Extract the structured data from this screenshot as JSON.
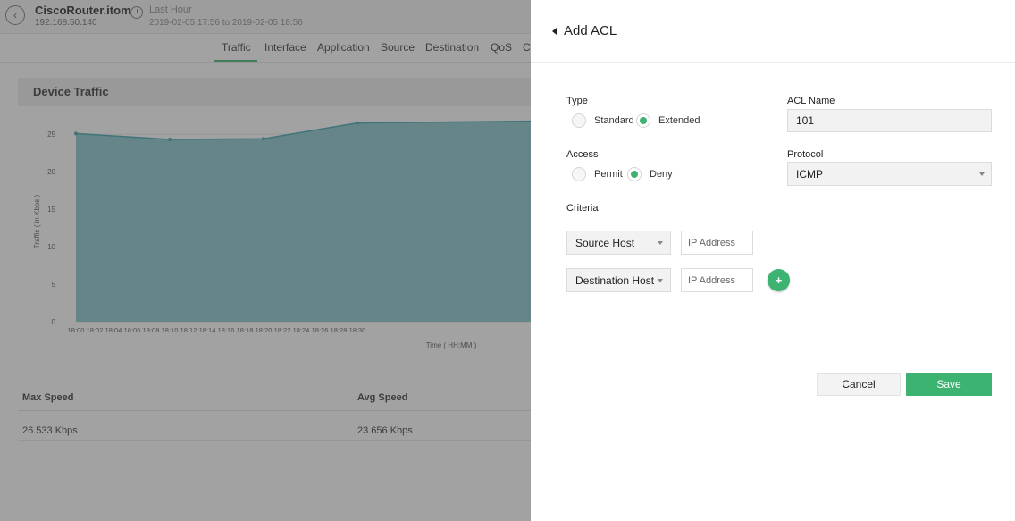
{
  "device": {
    "name": "CiscoRouter.itom",
    "ip": "192.168.50.140",
    "range_title": "Last Hour",
    "range_dates": "2019-02-05 17:56 to 2019-02-05 18:56"
  },
  "tabs": [
    "Traffic",
    "Interface",
    "Application",
    "Source",
    "Destination",
    "QoS",
    "C"
  ],
  "active_tab": "Traffic",
  "panel_title": "Device Traffic",
  "chart_data": {
    "type": "area",
    "xlabel": "Time ( HH:MM )",
    "ylabel": "Traffic ( in Kbps )",
    "x": [
      "18:00",
      "18:02",
      "18:04",
      "18:06",
      "18:08",
      "18:10",
      "18:12",
      "18:14",
      "18:16",
      "18:18",
      "18:20",
      "18:22",
      "18:24",
      "18:26",
      "18:28",
      "18:30"
    ],
    "points": [
      {
        "x": "18:00",
        "y": 25.1
      },
      {
        "x": "18:10",
        "y": 24.3
      },
      {
        "x": "18:20",
        "y": 24.4
      },
      {
        "x": "18:30",
        "y": 26.5
      }
    ],
    "y_ticks": [
      0,
      5,
      10,
      15,
      20,
      25
    ],
    "ylim": [
      0,
      28
    ],
    "fill_color": "#87c5cb",
    "line_color": "#3aa3ad"
  },
  "stats": {
    "max_label": "Max Speed",
    "avg_label": "Avg Speed",
    "max_value": "26.533 Kbps",
    "avg_value": "23.656 Kbps"
  },
  "acl": {
    "title": "Add ACL",
    "type_label": "Type",
    "type_options": [
      "Standard",
      "Extended"
    ],
    "type_selected": "Extended",
    "name_label": "ACL Name",
    "name_value": "101",
    "access_label": "Access",
    "access_options": [
      "Permit",
      "Deny"
    ],
    "access_selected": "Deny",
    "protocol_label": "Protocol",
    "protocol_value": "ICMP",
    "criteria_label": "Criteria",
    "source_select": "Source Host",
    "source_placeholder": "IP Address",
    "destination_select": "Destination Host",
    "destination_placeholder": "IP Address",
    "add_symbol": "+",
    "cancel_label": "Cancel",
    "save_label": "Save"
  },
  "colors": {
    "accent": "#3cb371"
  }
}
